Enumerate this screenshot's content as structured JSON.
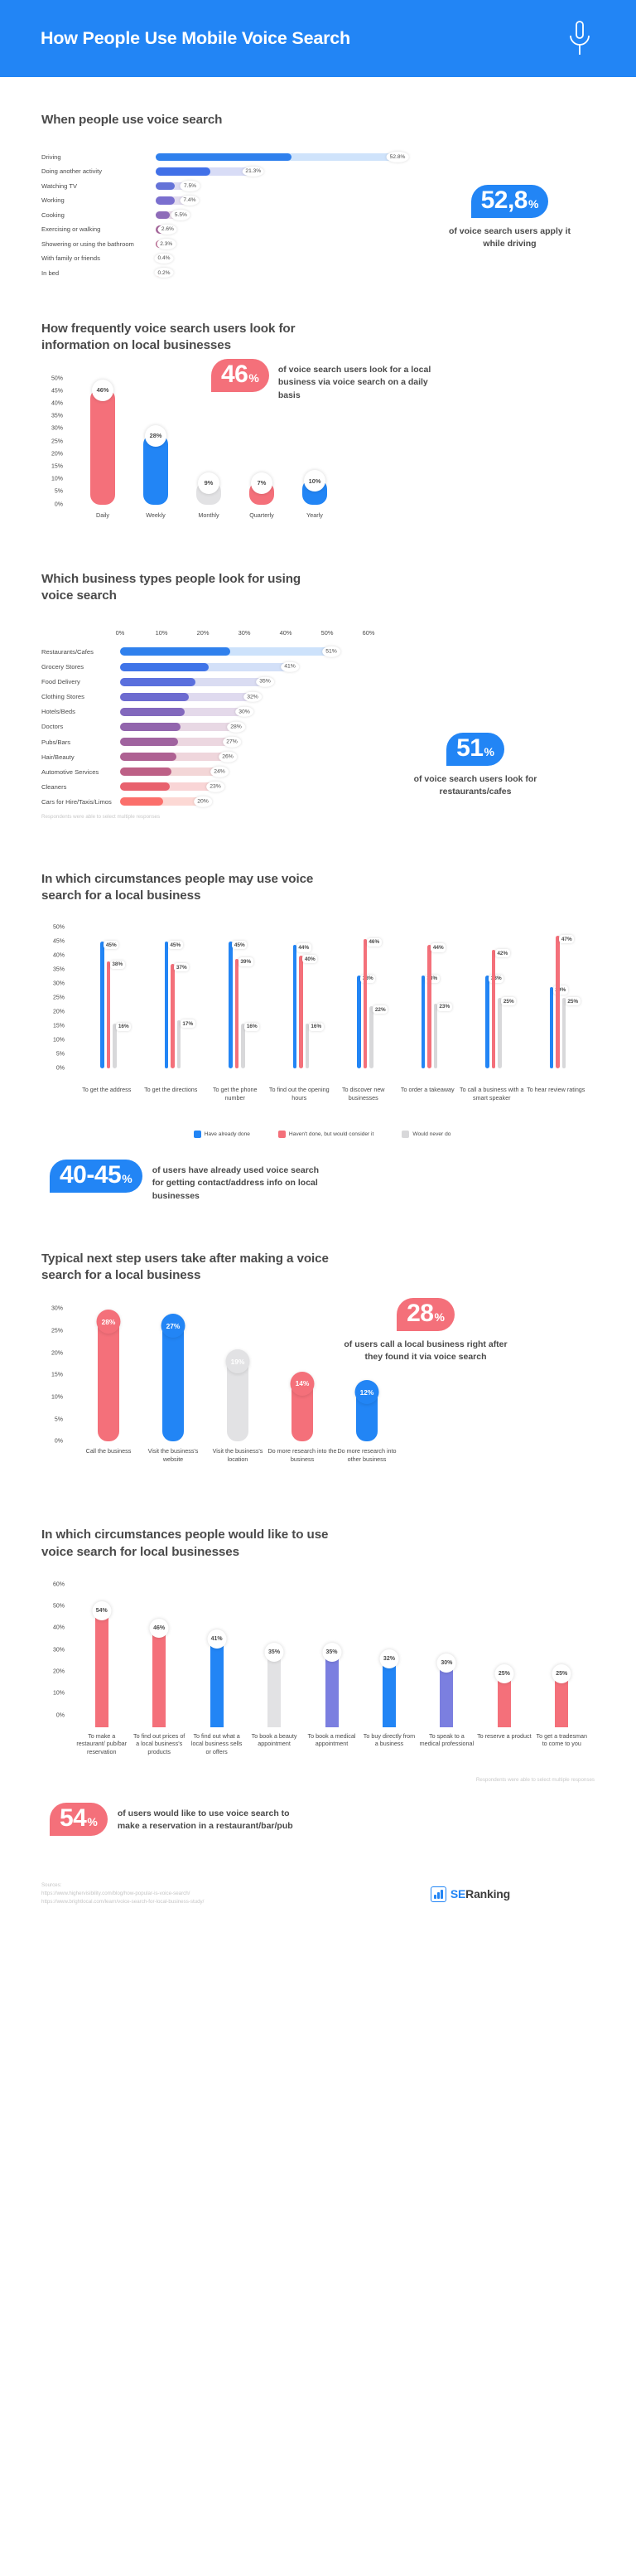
{
  "header": {
    "title": "How People Use Mobile Voice Search",
    "icon": "microphone-icon",
    "bg_color": "#2285f5"
  },
  "colors": {
    "blue": "#2285f5",
    "red": "#f4707a",
    "gray": "#e2e2e4",
    "text": "#4a4a4a",
    "muted": "#c5c5c5"
  },
  "sections": [
    {
      "id": "when-people-use",
      "title": "When people use voice search",
      "badge": {
        "value": "52,8",
        "unit": "%",
        "color": "#2285f5"
      },
      "badge_caption": "of voice search users apply it while driving",
      "chart_data": {
        "type": "bar",
        "orientation": "horizontal",
        "title": "When people use voice search",
        "xlabel": "",
        "ylabel": "",
        "xlim": [
          0,
          52.8
        ],
        "grid": false,
        "categories": [
          "Driving",
          "Doing another activity",
          "Watching TV",
          "Working",
          "Cooking",
          "Exercising or walking",
          "Showering or using the bathroom",
          "With family or friends",
          "In bed"
        ],
        "values": [
          52.8,
          21.3,
          7.5,
          7.4,
          5.5,
          2.6,
          2.3,
          0.4,
          0.2
        ],
        "labels": [
          "52.8%",
          "21.3%",
          "7.5%",
          "7.4%",
          "5.5%",
          "2.6%",
          "2.3%",
          "0.4%",
          "0.2%"
        ],
        "bar_colors": [
          "#2f80ed",
          "#4170e8",
          "#6573d8",
          "#7a6fcf",
          "#8e6cb9",
          "#a8689e",
          "#bc6590",
          "#e06178",
          "#fa6a6a"
        ],
        "track_colors": [
          "#cfe3fb",
          "#d8dcf6",
          "#dedcf2",
          "#e2dcee",
          "#e8dbe8",
          "#eedae2",
          "#f2d9dd",
          "#f8d8d8",
          "#fcd9d6"
        ]
      }
    },
    {
      "id": "how-frequently",
      "title": "How frequently voice search users look for information on local businesses",
      "badge": {
        "value": "46",
        "unit": "%",
        "color": "#f4707a"
      },
      "badge_caption": "of voice search users look for a local business via voice search on a daily basis",
      "chart_data": {
        "type": "bar",
        "orientation": "vertical",
        "title": "How frequently voice search users look for information on local businesses",
        "xlabel": "",
        "ylabel": "",
        "ylim": [
          0,
          50
        ],
        "yticks": [
          "0%",
          "5%",
          "10%",
          "15%",
          "20%",
          "25%",
          "30%",
          "35%",
          "40%",
          "45%",
          "50%"
        ],
        "grid": false,
        "categories": [
          "Daily",
          "Weekly",
          "Monthly",
          "Quarterly",
          "Yearly"
        ],
        "values": [
          46,
          28,
          9,
          7,
          10
        ],
        "labels": [
          "46%",
          "28%",
          "9%",
          "7%",
          "10%"
        ],
        "bar_colors": [
          "#f4707a",
          "#2285f5",
          "#e2e2e4",
          "#f4707a",
          "#2285f5"
        ]
      }
    },
    {
      "id": "business-types",
      "title": "Which business types people look for using voice search",
      "badge": {
        "value": "51",
        "unit": "%",
        "color": "#2285f5"
      },
      "badge_caption": "of voice search users look for restaurants/cafes",
      "note": "Respondents were able to select multiple responses",
      "chart_data": {
        "type": "bar",
        "orientation": "horizontal",
        "title": "Which business types people look for using voice search",
        "xlabel": "",
        "ylabel": "",
        "xlim": [
          0,
          60
        ],
        "xticks": [
          "0%",
          "10%",
          "20%",
          "30%",
          "40%",
          "50%",
          "60%"
        ],
        "grid": false,
        "categories": [
          "Restaurants/Cafes",
          "Grocery Stores",
          "Food Delivery",
          "Clothing Stores",
          "Hotels/Beds",
          "Doctors",
          "Pubs/Bars",
          "Hair/Beauty",
          "Automotive Services",
          "Cleaners",
          "Cars for Hire/Taxis/Limos"
        ],
        "values": [
          51,
          41,
          35,
          32,
          30,
          28,
          27,
          26,
          24,
          23,
          20
        ],
        "labels": [
          "51%",
          "41%",
          "35%",
          "32%",
          "30%",
          "28%",
          "27%",
          "26%",
          "24%",
          "23%",
          "20%"
        ],
        "bar_colors": [
          "#2f80ed",
          "#3f74e8",
          "#5a6fdd",
          "#6d6bd0",
          "#8268bd",
          "#9265ad",
          "#a0639f",
          "#ae6192",
          "#bd6086",
          "#e8616e",
          "#fb6f6b"
        ],
        "track_colors": [
          "#cde2fb",
          "#d3e0f8",
          "#dadcf2",
          "#dfdaef",
          "#e4d9ea",
          "#e8d8e4",
          "#ecd7e0",
          "#efd6dc",
          "#f3d6d7",
          "#f9d5d6",
          "#fcd8d4"
        ]
      }
    },
    {
      "id": "circumstances-may-use",
      "title": "In which circumstances people may use voice search for a local business",
      "badge": {
        "value": "40-45",
        "unit": "%",
        "color": "#2285f5"
      },
      "badge_caption": "of users have already used voice search for getting contact/address info on local businesses",
      "legend": [
        {
          "label": "Have already done",
          "color": "#2285f5"
        },
        {
          "label": "Haven't done, but would consider it",
          "color": "#f4707a"
        },
        {
          "label": "Would never do",
          "color": "#d8d8da"
        }
      ],
      "chart_data": {
        "type": "bar",
        "orientation": "vertical",
        "grouped": true,
        "title": "In which circumstances people may use voice search for a local business",
        "xlabel": "",
        "ylabel": "",
        "ylim": [
          0,
          50
        ],
        "yticks": [
          "0%",
          "5%",
          "10%",
          "15%",
          "20%",
          "25%",
          "30%",
          "35%",
          "40%",
          "45%",
          "50%"
        ],
        "grid": false,
        "categories": [
          "To get the address",
          "To get the directions",
          "To get the phone number",
          "To find out the opening hours",
          "To discover new businesses",
          "To order a takeaway",
          "To call a business with a smart speaker",
          "To hear review ratings"
        ],
        "series": [
          {
            "name": "Have already done",
            "color": "#2285f5",
            "values": [
              45,
              45,
              45,
              44,
              33,
              33,
              33,
              29
            ],
            "labels": [
              "45%",
              "45%",
              "45%",
              "44%",
              "33%",
              "33%",
              "33%",
              "29%"
            ]
          },
          {
            "name": "Haven't done, but would consider it",
            "color": "#f4707a",
            "values": [
              38,
              37,
              39,
              40,
              46,
              44,
              42,
              47
            ],
            "labels": [
              "38%",
              "37%",
              "39%",
              "40%",
              "46%",
              "44%",
              "42%",
              "47%"
            ]
          },
          {
            "name": "Would never do",
            "color": "#d8d8da",
            "values": [
              16,
              17,
              16,
              16,
              22,
              23,
              25,
              25
            ],
            "labels": [
              "16%",
              "17%",
              "16%",
              "16%",
              "22%",
              "23%",
              "25%",
              "25%"
            ]
          }
        ]
      }
    },
    {
      "id": "typical-next-step",
      "title": "Typical next step users take after making a voice search for a local business",
      "badge": {
        "value": "28",
        "unit": "%",
        "color": "#f4707a"
      },
      "badge_caption": "of users call a local business right after they found it via voice search",
      "chart_data": {
        "type": "bar",
        "orientation": "vertical",
        "title": "Typical next step users take after making a voice search for a local business",
        "xlabel": "",
        "ylabel": "",
        "ylim": [
          0,
          30
        ],
        "yticks": [
          "0%",
          "5%",
          "10%",
          "15%",
          "20%",
          "25%",
          "30%"
        ],
        "grid": false,
        "categories": [
          "Call the business",
          "Visit the business's website",
          "Visit the business's location",
          "Do more research into the business",
          "Do more research into other business"
        ],
        "values": [
          28,
          27,
          19,
          14,
          12
        ],
        "labels": [
          "28%",
          "27%",
          "19%",
          "14%",
          "12%"
        ],
        "bar_colors": [
          "#f4707a",
          "#2285f5",
          "#e2e2e4",
          "#f4707a",
          "#2285f5"
        ]
      }
    },
    {
      "id": "circumstances-would-like",
      "title": "In which circumstances people would like to use voice search for local businesses",
      "badge": {
        "value": "54",
        "unit": "%",
        "color": "#f4707a"
      },
      "badge_caption": "of users would like to use voice search to make a reservation in a restaurant/bar/pub",
      "note": "Respondents were able to select multiple responses",
      "chart_data": {
        "type": "bar",
        "orientation": "vertical",
        "title": "In which circumstances people would like to use voice search for local businesses",
        "xlabel": "",
        "ylabel": "",
        "ylim": [
          0,
          60
        ],
        "yticks": [
          "0%",
          "10%",
          "20%",
          "30%",
          "40%",
          "50%",
          "60%"
        ],
        "grid": false,
        "categories": [
          "To make a restaurant/ pub/bar reservation",
          "To find out prices of a local business's products",
          "To find out what a local business sells or offers",
          "To book a beauty appointment",
          "To book a medical appointment",
          "To buy directly from a business",
          "To speak to a medical professional",
          "To reserve a product",
          "To get a tradesman to come to you"
        ],
        "values": [
          54,
          46,
          41,
          35,
          35,
          32,
          30,
          25,
          25
        ],
        "labels": [
          "54%",
          "46%",
          "41%",
          "35%",
          "35%",
          "32%",
          "30%",
          "25%",
          "25%"
        ],
        "bar_colors": [
          "#f4707a",
          "#f4707a",
          "#2285f5",
          "#e2e2e4",
          "#7b7fe0",
          "#2285f5",
          "#7b7fe0",
          "#f4707a",
          "#f4707a"
        ]
      }
    }
  ],
  "footer": {
    "sources_label": "Sources:",
    "source_1": "https://www.highervisibility.com/blog/how-popular-is-voice-search/",
    "source_2": "https://www.brightlocal.com/learn/voice-search-for-local-business-study/",
    "logo_se": "SE",
    "logo_ranking": "Ranking"
  }
}
